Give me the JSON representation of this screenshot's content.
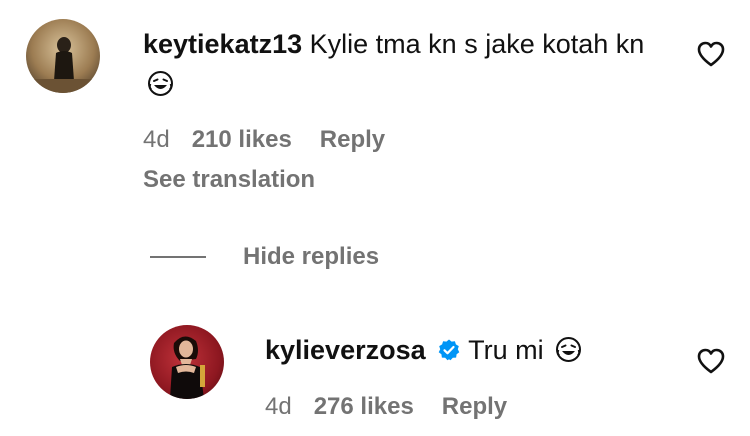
{
  "comment": {
    "username": "keytiekatz13",
    "text": "Kylie tma kn s jake kotah kn",
    "emoji": "laughing-face",
    "time": "4d",
    "likes": "210 likes",
    "reply_label": "Reply",
    "see_translation": "See translation",
    "hide_replies": "Hide replies"
  },
  "reply": {
    "username": "kylieverzosa",
    "verified": true,
    "text": "Tru mi",
    "emoji": "laughing-face",
    "time": "4d",
    "likes": "276 likes",
    "reply_label": "Reply"
  },
  "colors": {
    "text": "#111111",
    "secondary": "#737373",
    "verified_badge": "#0095f6"
  },
  "icons": [
    "heart-outline",
    "verified-badge",
    "laughing-face"
  ]
}
